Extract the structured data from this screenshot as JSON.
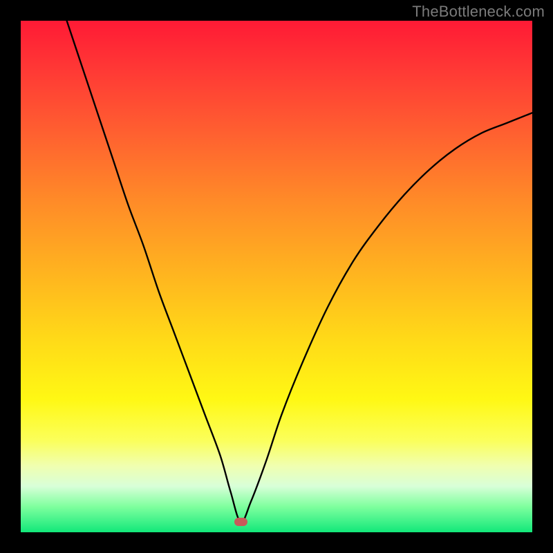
{
  "watermark": {
    "text": "TheBottleneck.com"
  },
  "chart_data": {
    "type": "line",
    "title": "",
    "xlabel": "",
    "ylabel": "",
    "xlim": [
      0,
      100
    ],
    "ylim": [
      0,
      100
    ],
    "gradient_meaning": "bottleneck severity (red=high, green=low)",
    "minimum_point": {
      "x": 43,
      "y": 2
    },
    "series": [
      {
        "name": "bottleneck-curve",
        "x": [
          9,
          12,
          15,
          18,
          21,
          24,
          27,
          30,
          33,
          36,
          39,
          41,
          43,
          45,
          48,
          51,
          55,
          60,
          65,
          70,
          75,
          80,
          85,
          90,
          95,
          100
        ],
        "y": [
          100,
          91,
          82,
          73,
          64,
          56,
          47,
          39,
          31,
          23,
          15,
          8,
          2,
          6,
          14,
          23,
          33,
          44,
          53,
          60,
          66,
          71,
          75,
          78,
          80,
          82
        ]
      }
    ],
    "marker": {
      "x": 43,
      "y": 2,
      "w": 2.6,
      "h": 1.6,
      "color": "#c85a5a"
    }
  }
}
